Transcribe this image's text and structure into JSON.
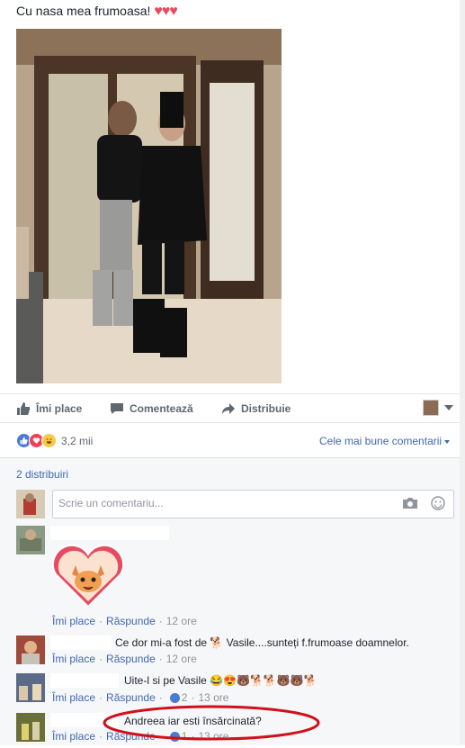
{
  "post": {
    "text": "Cu nasa mea frumoasa!",
    "hearts": "♥♥♥"
  },
  "actions": {
    "like": "Îmi place",
    "comment": "Comentează",
    "share": "Distribuie"
  },
  "reactions": {
    "count": "3,2 mii",
    "sort_label": "Cele mai bune comentarii"
  },
  "shares": "2 distribuiri",
  "comment_box": {
    "placeholder": "Scrie un comentariu..."
  },
  "comments": [
    {
      "text": "",
      "like": "Îmi place",
      "reply": "Răspunde",
      "time": "12 ore"
    },
    {
      "text": "Ce dor mi-a fost de 🐕 Vasile....sunteți f.frumoase doamnelor.",
      "like": "Îmi place",
      "reply": "Răspunde",
      "time": "12 ore"
    },
    {
      "text": "Uite-l si pe Vasile 😂😍🐻🐕🐕🐻🐻🐕",
      "like": "Îmi place",
      "reply": "Răspunde",
      "likes": "2",
      "time": "13 ore"
    },
    {
      "text": "Andreea iar esti însărcinată?",
      "like": "Îmi place",
      "reply": "Răspunde",
      "likes": "1",
      "time": "13 ore"
    }
  ],
  "colors": {
    "link": "#4267b2",
    "muted": "#90949c",
    "annotation": "#d0101a"
  }
}
